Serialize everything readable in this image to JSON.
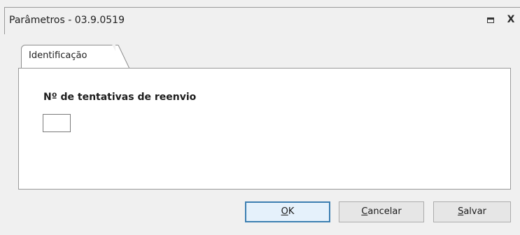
{
  "window": {
    "title": "Parâmetros - 03.9.0519",
    "maximize_icon": "maximize-icon",
    "close_label": "X"
  },
  "tabs": [
    {
      "label": "Identificação",
      "active": true
    }
  ],
  "form": {
    "retry_label": "Nº de tentativas de reenvio",
    "retry_value": ""
  },
  "buttons": {
    "ok": {
      "mnemonic": "O",
      "rest": "K"
    },
    "cancel": {
      "mnemonic": "C",
      "rest": "ancelar"
    },
    "save": {
      "mnemonic": "S",
      "rest": "alvar"
    }
  },
  "colors": {
    "background": "#f0f0f0",
    "panel": "#ffffff",
    "default_button_border": "#3c7fb1"
  }
}
